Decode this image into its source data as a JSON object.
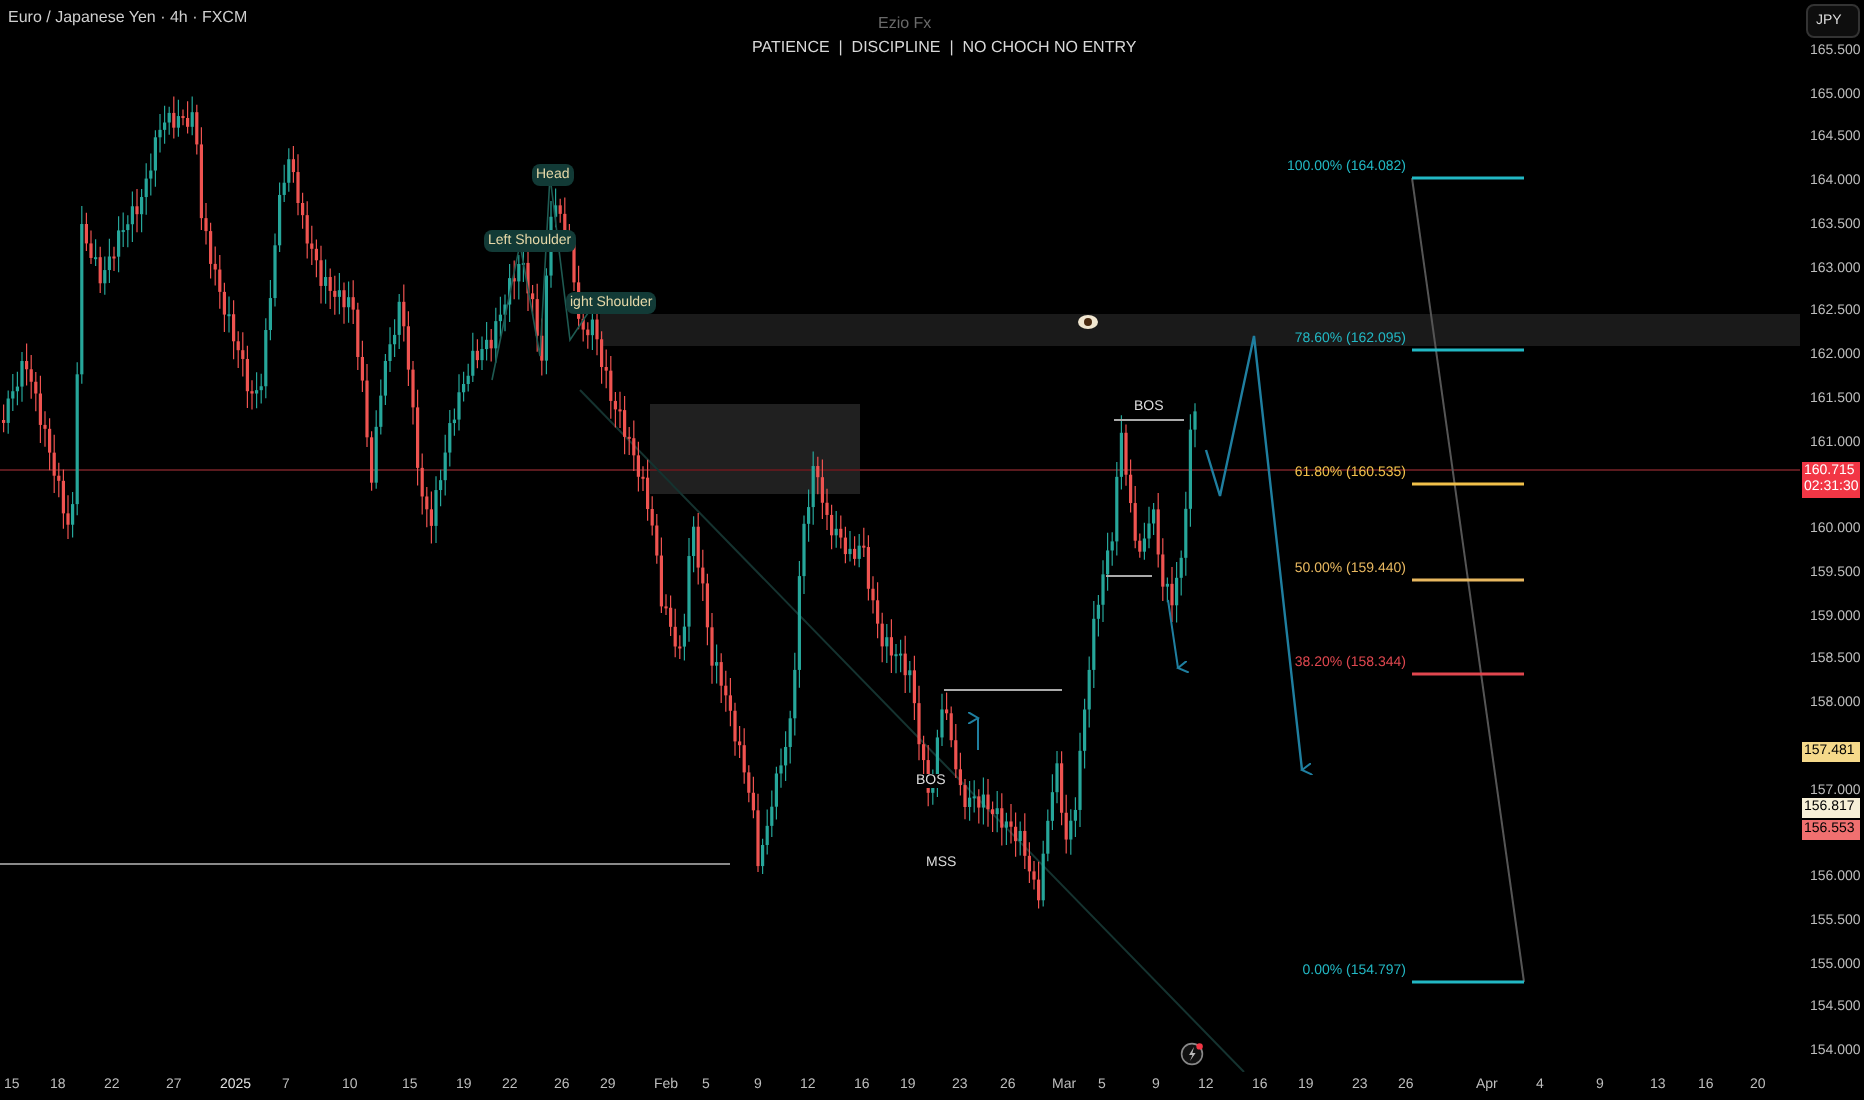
{
  "header": {
    "symbol": "Euro / Japanese Yen · 4h · FXCM",
    "watermark": "Ezio Fx",
    "note": "PATIENCE  |  DISCIPLINE  |  NO CHOCH NO ENTRY",
    "currency_button": "JPY"
  },
  "price_axis": [
    "165.500",
    "165.000",
    "164.500",
    "164.000",
    "163.500",
    "163.000",
    "162.500",
    "162.000",
    "161.500",
    "161.000",
    "160.000",
    "159.500",
    "159.000",
    "158.500",
    "158.000",
    "157.000",
    "156.000",
    "155.500",
    "155.000",
    "154.500",
    "154.000"
  ],
  "time_axis": [
    "15",
    "18",
    "22",
    "27",
    "2025",
    "7",
    "10",
    "15",
    "19",
    "22",
    "26",
    "29",
    "Feb",
    "5",
    "9",
    "12",
    "16",
    "19",
    "23",
    "26",
    "Mar",
    "5",
    "9",
    "12",
    "16",
    "19",
    "23",
    "26",
    "Apr",
    "4",
    "9",
    "13",
    "16",
    "20"
  ],
  "pattern_labels": [
    "Head",
    "Left Shoulder",
    "ight Shoulder"
  ],
  "structure_labels": [
    "BOS",
    "BOS",
    "MSS"
  ],
  "fib_levels": [
    {
      "label": "100.00% (164.082)",
      "color": "#22b8c4"
    },
    {
      "label": "78.60% (162.095)",
      "color": "#22b8c4"
    },
    {
      "label": "61.80% (160.535)",
      "color": "#f0c04a"
    },
    {
      "label": "50.00% (159.440)",
      "color": "#e8b860"
    },
    {
      "label": "38.20% (158.344)",
      "color": "#e0474f"
    },
    {
      "label": "0.00% (154.797)",
      "color": "#22b8c4"
    }
  ],
  "price_badges": [
    {
      "text": "160.715",
      "subtext": "02:31:30",
      "color": "#f23645"
    },
    {
      "text": "157.481",
      "color": "#f5d98a"
    },
    {
      "text": "156.817",
      "color": "#f7f0d8"
    },
    {
      "text": "156.553",
      "color": "#f07070"
    }
  ]
}
